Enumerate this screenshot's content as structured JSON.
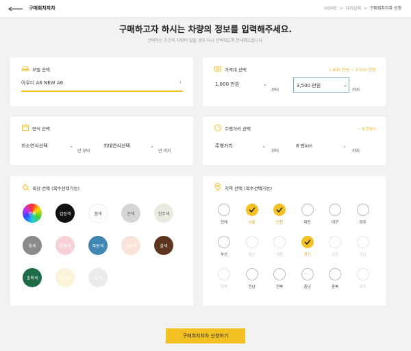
{
  "header": {
    "title": "구매희차차차",
    "breadcrumb": [
      "HOME",
      "내차살때",
      "구매희차차차 신청"
    ],
    "crumb_sep": ">"
  },
  "heading": "구매하고자 하시는 차량의 정보를 입력해주세요.",
  "subheading": "선택하신 조건의 차량이 없을 경우 다시 선택하도록 안내해드립니다.",
  "model": {
    "title": "모델 선택",
    "value": "아우디 A6 NEW A6"
  },
  "price": {
    "title": "가격대 선택",
    "hint": "1,800 만원 ~ 3,500 만원",
    "from": "1,800 만원",
    "from_unit": "부터",
    "to": "3,500 만원",
    "to_unit": "까지"
  },
  "year": {
    "title": "연식 선택",
    "from": "최소연식선택",
    "from_unit": "년 부터",
    "to": "최대연식선택",
    "to_unit": "년 까지"
  },
  "mileage": {
    "title": "주행거리 선택",
    "hint": "~ 8 만km",
    "from": "주행거리",
    "from_unit": "부터",
    "to": "8 만km",
    "to_unit": "까지"
  },
  "colors": {
    "title": "색상 선택 (복수선택가능)",
    "items": [
      {
        "label": "전체",
        "bg": "conic",
        "fg": "#ffffff"
      },
      {
        "label": "검정색",
        "bg": "#111111",
        "fg": "#ffffff"
      },
      {
        "label": "흰색",
        "bg": "#ffffff",
        "fg": "#333333"
      },
      {
        "label": "은색",
        "bg": "#d6d6d6",
        "fg": "#555555"
      },
      {
        "label": "진주색",
        "bg": "#e9ebe0",
        "fg": "#555555"
      },
      {
        "label": "회색",
        "bg": "#8a8a8a",
        "fg": "#ffffff"
      },
      {
        "label": "분홍색",
        "bg": "#f7d1d6",
        "fg": "#ffffff"
      },
      {
        "label": "파랑색",
        "bg": "#3f86b3",
        "fg": "#ffffff"
      },
      {
        "label": "살구색",
        "bg": "#f8e4d8",
        "fg": "#ffffff"
      },
      {
        "label": "갈색",
        "bg": "#5e3620",
        "fg": "#ffffff"
      },
      {
        "label": "초록색",
        "bg": "#1e6b47",
        "fg": "#ffffff"
      },
      {
        "label": "노랑색",
        "bg": "#fbf3d7",
        "fg": "#ffffff"
      },
      {
        "label": "회색",
        "bg": "#ebebeb",
        "fg": "#ffffff"
      }
    ]
  },
  "regions": {
    "title": "지역 선택 (복수선택가능)",
    "items": [
      {
        "label": "전체",
        "state": "off"
      },
      {
        "label": "서울",
        "state": "on"
      },
      {
        "label": "인천",
        "state": "on"
      },
      {
        "label": "대전",
        "state": "off"
      },
      {
        "label": "대구",
        "state": "off"
      },
      {
        "label": "광주",
        "state": "off"
      },
      {
        "label": "부산",
        "state": "off"
      },
      {
        "label": "울산",
        "state": "dis"
      },
      {
        "label": "세종",
        "state": "dis"
      },
      {
        "label": "경기",
        "state": "on"
      },
      {
        "label": "강원",
        "state": "dis"
      },
      {
        "label": "경남",
        "state": "dis"
      },
      {
        "label": "경북",
        "state": "dis"
      },
      {
        "label": "전남",
        "state": "off"
      },
      {
        "label": "전북",
        "state": "off"
      },
      {
        "label": "충남",
        "state": "off"
      },
      {
        "label": "충북",
        "state": "off"
      },
      {
        "label": "제주",
        "state": "dis"
      }
    ]
  },
  "submit_label": "구매희차차차 신청하기",
  "accent": "#f4c125"
}
